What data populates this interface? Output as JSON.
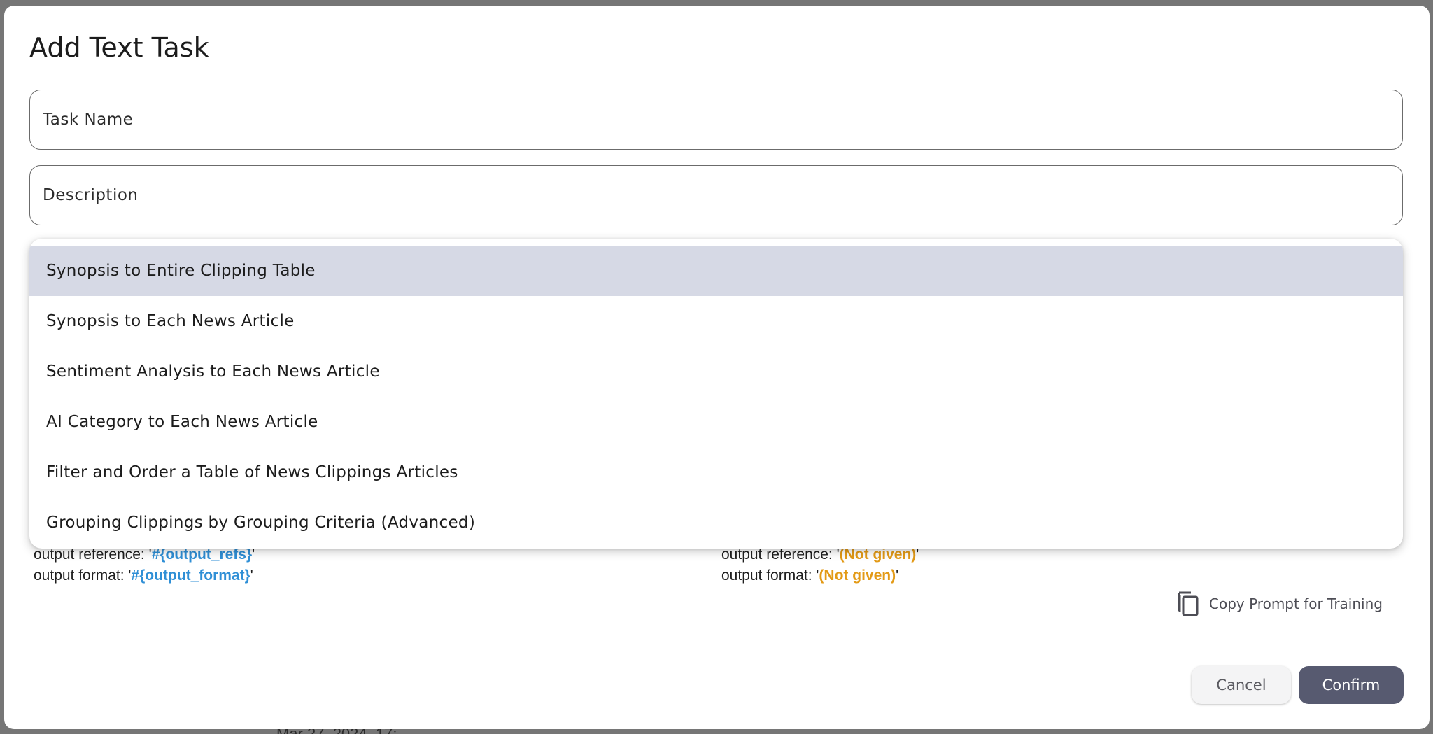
{
  "dialog": {
    "title": "Add Text Task"
  },
  "fields": {
    "task_name": {
      "placeholder": "Task Name",
      "value": ""
    },
    "description": {
      "placeholder": "Description",
      "value": ""
    }
  },
  "dropdown": {
    "selected_index": 0,
    "options": [
      "Synopsis to Entire Clipping Table",
      "Synopsis to Each News Article",
      "Sentiment Analysis to Each News Article",
      "AI Category to Each News Article",
      "Filter and Order a Table of News Clippings Articles",
      "Grouping Clippings by Grouping Criteria (Advanced)"
    ]
  },
  "preview": {
    "left": {
      "ref_prefix": "output reference: '",
      "ref_value": "#{output_refs}",
      "ref_suffix": "'",
      "format_prefix": "output format: '",
      "format_value": "#{output_format}",
      "format_suffix": "'"
    },
    "right": {
      "ref_prefix": "output reference: '",
      "ref_value": "(Not given)",
      "ref_suffix": "'",
      "format_prefix": "output format: '",
      "format_value": "(Not given)",
      "format_suffix": "'"
    }
  },
  "actions": {
    "copy_prompt_label": "Copy Prompt for Training",
    "cancel_label": "Cancel",
    "confirm_label": "Confirm"
  },
  "background": {
    "peek_text": "Mar 27, 2024, 17:"
  },
  "colors": {
    "confirm_bg": "#575a70",
    "selected_item_bg": "#d6d9e5",
    "variable_blue": "#2f8fd6",
    "not_given_orange": "#e39a16"
  }
}
